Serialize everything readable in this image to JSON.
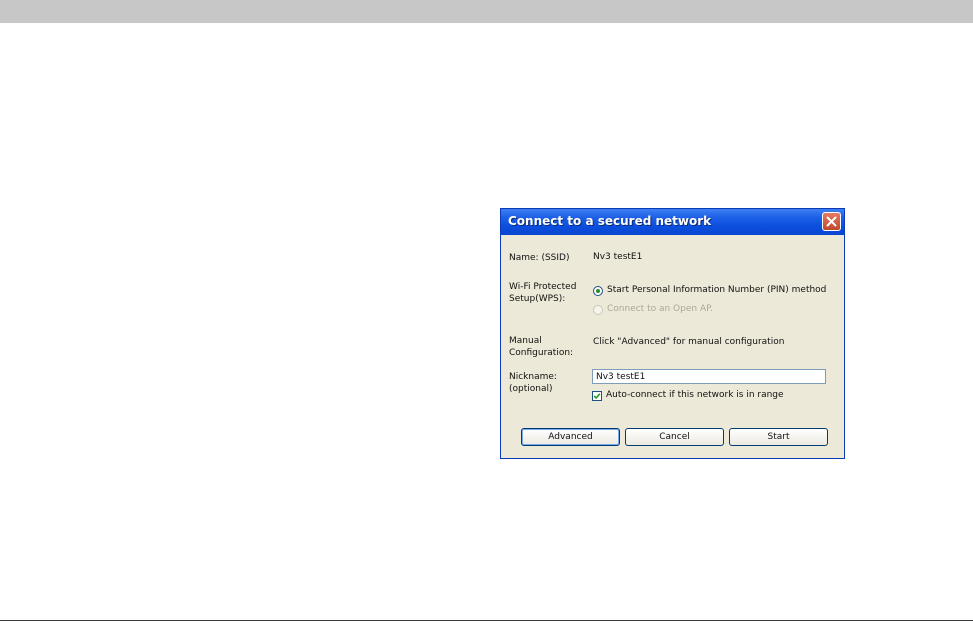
{
  "dialog": {
    "title": "Connect to a secured network",
    "name_label": "Name:  (SSID)",
    "ssid_value": "Nv3 testE1",
    "wps_label": "Wi-Fi Protected Setup(WPS):",
    "wps_options": [
      {
        "label": "Start Personal Information Number (PIN) method",
        "selected": true,
        "enabled": true
      },
      {
        "label": "Connect to an Open AP.",
        "selected": false,
        "enabled": false
      }
    ],
    "manual_label": "Manual Configuration:",
    "manual_text": "Click \"Advanced\" for manual configuration",
    "nickname_label": "Nickname: (optional)",
    "nickname_value": "Nv3 testE1",
    "autoconnect_label": "Auto-connect if this network is in range",
    "autoconnect_checked": true,
    "buttons": {
      "advanced": "Advanced",
      "cancel": "Cancel",
      "start": "Start"
    }
  },
  "colors": {
    "titlebar": "#0b4ddc",
    "dialog_bg": "#ece9d8",
    "close_button": "#c0472b",
    "top_bar": "#c7c7c7"
  },
  "icons": {
    "close": "close-icon",
    "check": "checkmark-icon"
  }
}
